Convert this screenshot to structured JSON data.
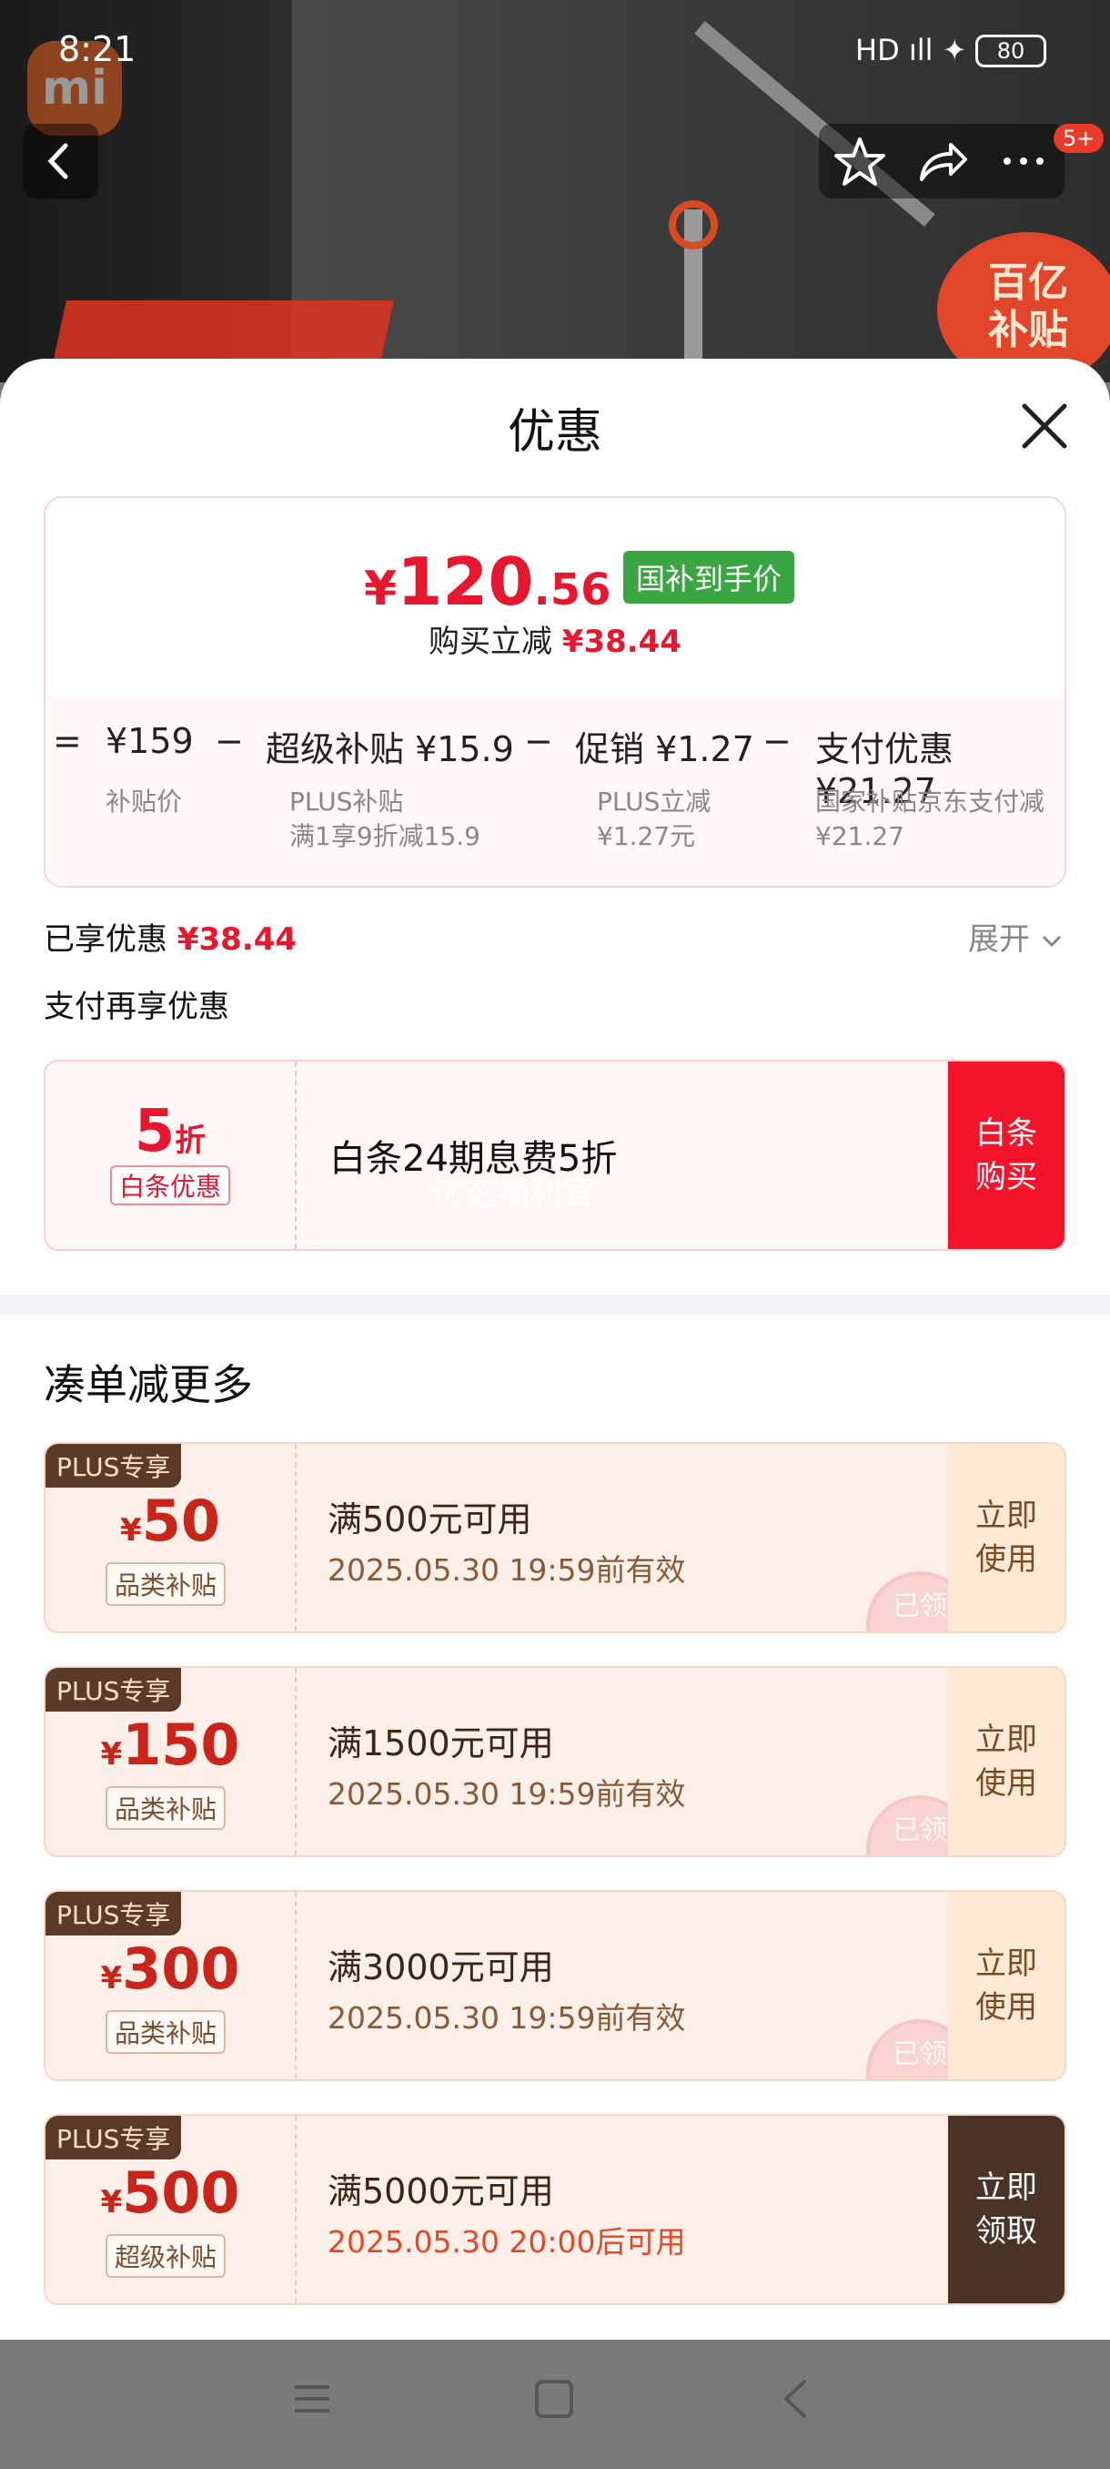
{
  "status": {
    "time": "8:21",
    "signal": "HD ıll ✦",
    "battery": "80"
  },
  "background": {
    "logo": "mi",
    "badge": "百亿\n补贴"
  },
  "top_actions": {
    "count_badge": "5+"
  },
  "sheet": {
    "title": "优惠"
  },
  "price_summary": {
    "currency": "¥",
    "price_int": "120",
    "price_dec": ".56",
    "tag": "国补到手价",
    "reduce_label": "购买立减",
    "reduce_value": "¥38.44",
    "breakdown": {
      "eq": "=",
      "base": "¥159",
      "base_sub": "补贴价",
      "minus1": "−",
      "item1": "超级补贴 ¥15.9",
      "item1_sub1": "PLUS补贴",
      "item1_sub2": "满1享9折减15.9",
      "minus2": "−",
      "item2": "促销 ¥1.27",
      "item2_sub1": "PLUS立减",
      "item2_sub2": "¥1.27元",
      "minus3": "−",
      "item3": "支付优惠 ¥21.27",
      "item3_sub1": "国家补贴京东支付减",
      "item3_sub2": "¥21.27"
    }
  },
  "enjoyed": {
    "label": "已享优惠",
    "value": "¥38.44",
    "expand": "展开"
  },
  "pay_again": {
    "label": "支付再享优惠"
  },
  "baitiao": {
    "discount_num": "5",
    "discount_unit": "折",
    "tag": "白条优惠",
    "desc": "白条24期息费5折",
    "watermark": "优选福利官",
    "button": "白条\n购买"
  },
  "more": {
    "title": "凑单减更多"
  },
  "coupons": [
    {
      "badge": "PLUS专享",
      "currency": "¥",
      "amount": "50",
      "tag": "品类补贴",
      "condition": "满500元可用",
      "validity": "2025.05.30 19:59前有效",
      "button": "立即\n使用",
      "stamp": "已领"
    },
    {
      "badge": "PLUS专享",
      "currency": "¥",
      "amount": "150",
      "tag": "品类补贴",
      "condition": "满1500元可用",
      "validity": "2025.05.30 19:59前有效",
      "button": "立即\n使用",
      "stamp": "已领"
    },
    {
      "badge": "PLUS专享",
      "currency": "¥",
      "amount": "300",
      "tag": "品类补贴",
      "condition": "满3000元可用",
      "validity": "2025.05.30 19:59前有效",
      "button": "立即\n使用",
      "stamp": "已领"
    },
    {
      "badge": "PLUS专享",
      "currency": "¥",
      "amount": "500",
      "tag": "超级补贴",
      "condition": "满5000元可用",
      "validity": "2025.05.30 20:00后可用",
      "button": "立即\n领取"
    }
  ],
  "colors": {
    "accent_red": "#e6172e",
    "green_tag": "#3aa642",
    "coupon_brown": "#5a3b28"
  }
}
